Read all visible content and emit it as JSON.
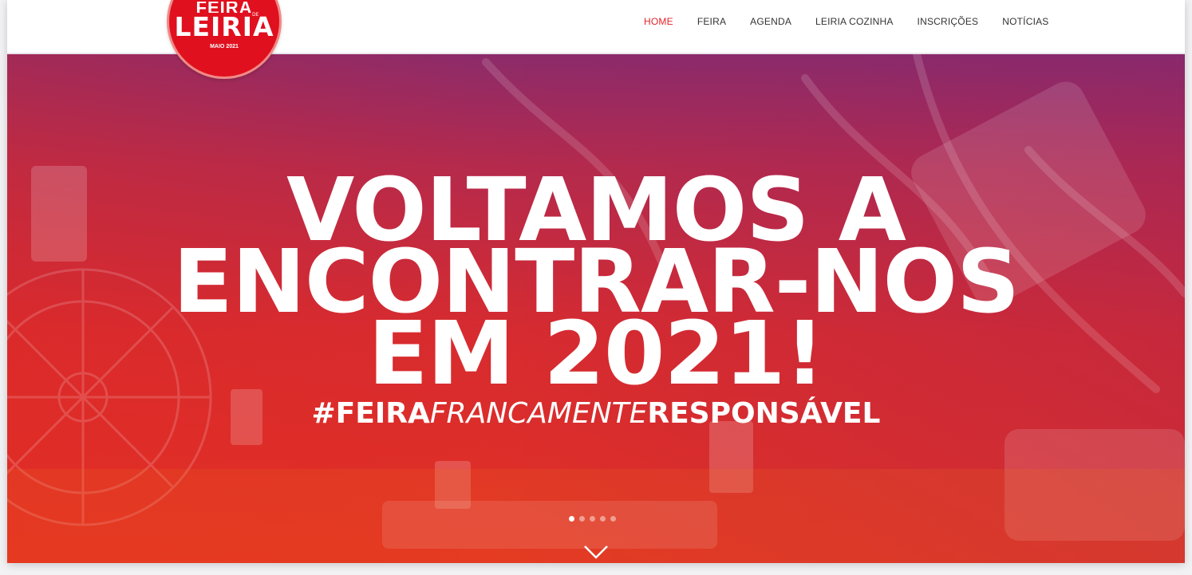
{
  "logo": {
    "top": "FEIRA",
    "de": "DE",
    "main": "LEIRIA",
    "sub": "MAIO 2021"
  },
  "nav": {
    "items": [
      "HOME",
      "FEIRA",
      "AGENDA",
      "LEIRIA COZINHA",
      "INSCRIÇÕES",
      "NOTÍCIAS"
    ],
    "active": "HOME"
  },
  "hero": {
    "headline": [
      "VOLTAMOS A",
      "ENCONTRAR-NOS",
      "EM 2021!"
    ],
    "tagline": {
      "part1": "#FEIRA",
      "part2": "FRANCAMENTE",
      "part3": "RESPONSÁVEL"
    },
    "slides_total": 5,
    "active_slide": 1
  },
  "icons": {
    "scroll_down": "chevron-down-icon"
  },
  "colors": {
    "brand_red": "#e0101f",
    "nav_active": "#e2232b",
    "hero_top": "#8c2b6a",
    "hero_bottom": "#e33024"
  }
}
